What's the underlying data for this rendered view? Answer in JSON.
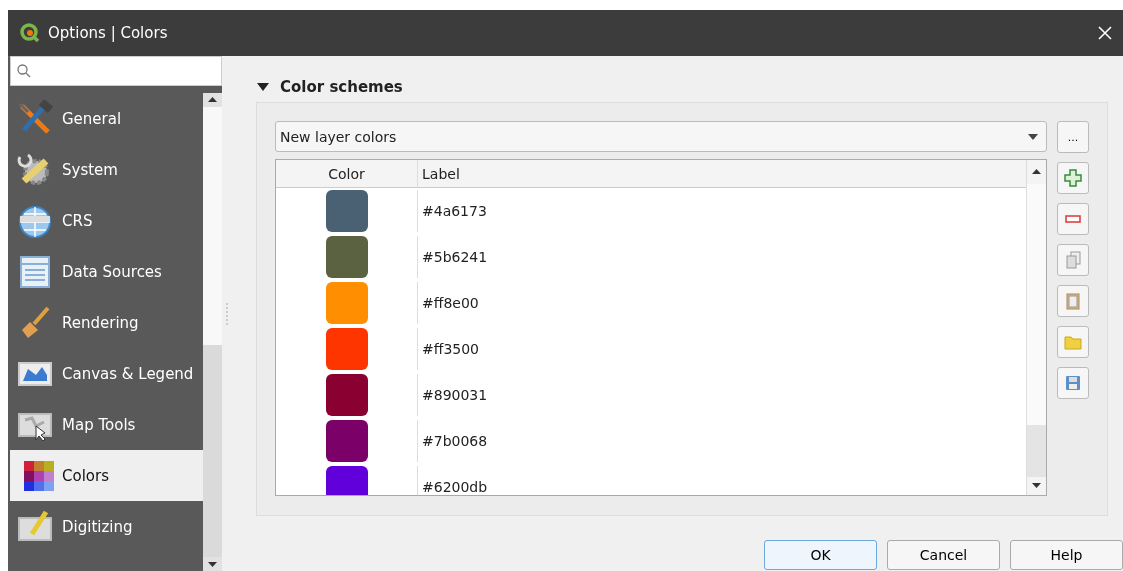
{
  "window": {
    "title": "Options | Colors"
  },
  "sidebar": {
    "items": [
      {
        "label": "General",
        "selected": false
      },
      {
        "label": "System",
        "selected": false
      },
      {
        "label": "CRS",
        "selected": false
      },
      {
        "label": "Data Sources",
        "selected": false
      },
      {
        "label": "Rendering",
        "selected": false
      },
      {
        "label": "Canvas & Legend",
        "selected": false
      },
      {
        "label": "Map Tools",
        "selected": false
      },
      {
        "label": "Colors",
        "selected": true
      },
      {
        "label": "Digitizing",
        "selected": false
      }
    ]
  },
  "section": {
    "title": "Color schemes",
    "expanded": true,
    "scheme": "New layer colors",
    "menu_button": "...",
    "table": {
      "columns": [
        "Color",
        "Label"
      ],
      "rows": [
        {
          "color": "#4a6173",
          "label": "#4a6173"
        },
        {
          "color": "#5b6241",
          "label": "#5b6241"
        },
        {
          "color": "#ff8e00",
          "label": "#ff8e00"
        },
        {
          "color": "#ff3500",
          "label": "#ff3500"
        },
        {
          "color": "#890031",
          "label": "#890031"
        },
        {
          "color": "#7b0068",
          "label": "#7b0068"
        },
        {
          "color": "#6200db",
          "label": "#6200db"
        }
      ]
    }
  },
  "buttons": [
    {
      "label": "OK",
      "default": true
    },
    {
      "label": "Cancel",
      "default": false
    },
    {
      "label": "Help",
      "default": false
    }
  ]
}
